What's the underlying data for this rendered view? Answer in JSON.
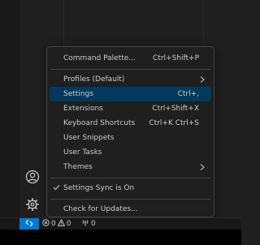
{
  "menu": {
    "items": [
      {
        "label": "Command Palette...",
        "shortcut": "Ctrl+Shift+P"
      },
      {
        "label": "Profiles (Default)"
      },
      {
        "label": "Settings",
        "shortcut": "Ctrl+,"
      },
      {
        "label": "Extensions",
        "shortcut": "Ctrl+Shift+X"
      },
      {
        "label": "Keyboard Shortcuts",
        "shortcut": "Ctrl+K Ctrl+S"
      },
      {
        "label": "User Snippets"
      },
      {
        "label": "User Tasks"
      },
      {
        "label": "Themes"
      },
      {
        "label": "Settings Sync is On"
      },
      {
        "label": "Check for Updates..."
      }
    ]
  },
  "status_bar": {
    "errors": "0",
    "warnings": "0",
    "ports": "0"
  },
  "activity_bar": {
    "icons": [
      "account-icon",
      "manage-gear-icon"
    ]
  },
  "colors": {
    "menu_bg": "#1f1f1f",
    "menu_highlight": "#04395e",
    "remote_button": "#0078d4",
    "text": "#cccccc"
  }
}
